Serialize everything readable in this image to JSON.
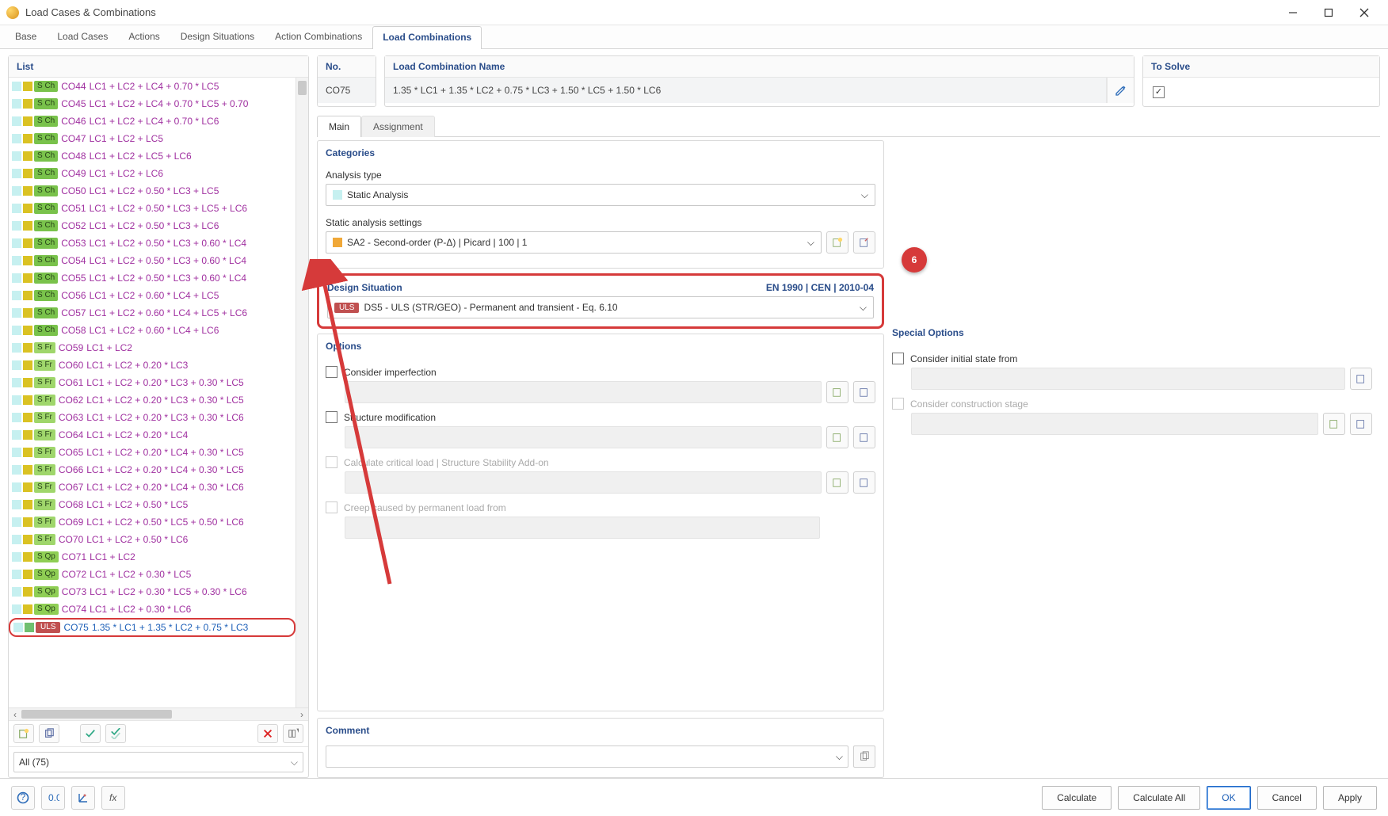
{
  "window": {
    "title": "Load Cases & Combinations"
  },
  "tabs": [
    "Base",
    "Load Cases",
    "Actions",
    "Design Situations",
    "Action Combinations",
    "Load Combinations"
  ],
  "active_tab": 5,
  "list": {
    "header": "List",
    "filter": "All (75)",
    "rows": [
      {
        "badge": "S Ch",
        "cls": "sch",
        "sq": "#dac223",
        "co": "CO44",
        "txt": "LC1 + LC2 + LC4 + 0.70 * LC5"
      },
      {
        "badge": "S Ch",
        "cls": "sch",
        "sq": "#dac223",
        "co": "CO45",
        "txt": "LC1 + LC2 + LC4 + 0.70 * LC5 + 0.70"
      },
      {
        "badge": "S Ch",
        "cls": "sch",
        "sq": "#dac223",
        "co": "CO46",
        "txt": "LC1 + LC2 + LC4 + 0.70 * LC6"
      },
      {
        "badge": "S Ch",
        "cls": "sch",
        "sq": "#dac223",
        "co": "CO47",
        "txt": "LC1 + LC2 + LC5"
      },
      {
        "badge": "S Ch",
        "cls": "sch",
        "sq": "#dac223",
        "co": "CO48",
        "txt": "LC1 + LC2 + LC5 + LC6"
      },
      {
        "badge": "S Ch",
        "cls": "sch",
        "sq": "#dac223",
        "co": "CO49",
        "txt": "LC1 + LC2 + LC6"
      },
      {
        "badge": "S Ch",
        "cls": "sch",
        "sq": "#dac223",
        "co": "CO50",
        "txt": "LC1 + LC2 + 0.50 * LC3 + LC5"
      },
      {
        "badge": "S Ch",
        "cls": "sch",
        "sq": "#dac223",
        "co": "CO51",
        "txt": "LC1 + LC2 + 0.50 * LC3 + LC5 + LC6"
      },
      {
        "badge": "S Ch",
        "cls": "sch",
        "sq": "#dac223",
        "co": "CO52",
        "txt": "LC1 + LC2 + 0.50 * LC3 + LC6"
      },
      {
        "badge": "S Ch",
        "cls": "sch",
        "sq": "#dac223",
        "co": "CO53",
        "txt": "LC1 + LC2 + 0.50 * LC3 + 0.60 * LC4"
      },
      {
        "badge": "S Ch",
        "cls": "sch",
        "sq": "#dac223",
        "co": "CO54",
        "txt": "LC1 + LC2 + 0.50 * LC3 + 0.60 * LC4"
      },
      {
        "badge": "S Ch",
        "cls": "sch",
        "sq": "#dac223",
        "co": "CO55",
        "txt": "LC1 + LC2 + 0.50 * LC3 + 0.60 * LC4"
      },
      {
        "badge": "S Ch",
        "cls": "sch",
        "sq": "#dac223",
        "co": "CO56",
        "txt": "LC1 + LC2 + 0.60 * LC4 + LC5"
      },
      {
        "badge": "S Ch",
        "cls": "sch",
        "sq": "#dac223",
        "co": "CO57",
        "txt": "LC1 + LC2 + 0.60 * LC4 + LC5 + LC6"
      },
      {
        "badge": "S Ch",
        "cls": "sch",
        "sq": "#dac223",
        "co": "CO58",
        "txt": "LC1 + LC2 + 0.60 * LC4 + LC6"
      },
      {
        "badge": "S Fr",
        "cls": "sfr",
        "sq": "#dac223",
        "co": "CO59",
        "txt": "LC1 + LC2"
      },
      {
        "badge": "S Fr",
        "cls": "sfr",
        "sq": "#dac223",
        "co": "CO60",
        "txt": "LC1 + LC2 + 0.20 * LC3"
      },
      {
        "badge": "S Fr",
        "cls": "sfr",
        "sq": "#dac223",
        "co": "CO61",
        "txt": "LC1 + LC2 + 0.20 * LC3 + 0.30 * LC5"
      },
      {
        "badge": "S Fr",
        "cls": "sfr",
        "sq": "#dac223",
        "co": "CO62",
        "txt": "LC1 + LC2 + 0.20 * LC3 + 0.30 * LC5"
      },
      {
        "badge": "S Fr",
        "cls": "sfr",
        "sq": "#dac223",
        "co": "CO63",
        "txt": "LC1 + LC2 + 0.20 * LC3 + 0.30 * LC6"
      },
      {
        "badge": "S Fr",
        "cls": "sfr",
        "sq": "#dac223",
        "co": "CO64",
        "txt": "LC1 + LC2 + 0.20 * LC4"
      },
      {
        "badge": "S Fr",
        "cls": "sfr",
        "sq": "#dac223",
        "co": "CO65",
        "txt": "LC1 + LC2 + 0.20 * LC4 + 0.30 * LC5"
      },
      {
        "badge": "S Fr",
        "cls": "sfr",
        "sq": "#dac223",
        "co": "CO66",
        "txt": "LC1 + LC2 + 0.20 * LC4 + 0.30 * LC5"
      },
      {
        "badge": "S Fr",
        "cls": "sfr",
        "sq": "#dac223",
        "co": "CO67",
        "txt": "LC1 + LC2 + 0.20 * LC4 + 0.30 * LC6"
      },
      {
        "badge": "S Fr",
        "cls": "sfr",
        "sq": "#dac223",
        "co": "CO68",
        "txt": "LC1 + LC2 + 0.50 * LC5"
      },
      {
        "badge": "S Fr",
        "cls": "sfr",
        "sq": "#dac223",
        "co": "CO69",
        "txt": "LC1 + LC2 + 0.50 * LC5 + 0.50 * LC6"
      },
      {
        "badge": "S Fr",
        "cls": "sfr",
        "sq": "#dac223",
        "co": "CO70",
        "txt": "LC1 + LC2 + 0.50 * LC6"
      },
      {
        "badge": "S Qp",
        "cls": "sqp",
        "sq": "#dac223",
        "co": "CO71",
        "txt": "LC1 + LC2"
      },
      {
        "badge": "S Qp",
        "cls": "sqp",
        "sq": "#dac223",
        "co": "CO72",
        "txt": "LC1 + LC2 + 0.30 * LC5"
      },
      {
        "badge": "S Qp",
        "cls": "sqp",
        "sq": "#dac223",
        "co": "CO73",
        "txt": "LC1 + LC2 + 0.30 * LC5 + 0.30 * LC6"
      },
      {
        "badge": "S Qp",
        "cls": "sqp",
        "sq": "#dac223",
        "co": "CO74",
        "txt": "LC1 + LC2 + 0.30 * LC6"
      },
      {
        "badge": "ULS",
        "cls": "uls",
        "sq": "#6fbf6f",
        "co": "CO75",
        "txt": "1.35 * LC1 + 1.35 * LC2 + 0.75 * LC3",
        "sel": true
      }
    ]
  },
  "detail": {
    "no_hdr": "No.",
    "no_val": "CO75",
    "name_hdr": "Load Combination Name",
    "name_val": "1.35 * LC1 + 1.35 * LC2 + 0.75 * LC3 + 1.50 * LC5 + 1.50 * LC6",
    "solve_hdr": "To Solve",
    "subtabs": [
      "Main",
      "Assignment"
    ],
    "categories_hdr": "Categories",
    "analysis_type_lbl": "Analysis type",
    "analysis_type_val": "Static Analysis",
    "static_settings_lbl": "Static analysis settings",
    "static_settings_val": "SA2 - Second-order (P-Δ) | Picard | 100 | 1",
    "ds_hdr": "Design Situation",
    "ds_std": "EN 1990 | CEN | 2010-04",
    "ds_badge": "ULS",
    "ds_val": "DS5 - ULS (STR/GEO) - Permanent and transient - Eq. 6.10",
    "options_hdr": "Options",
    "opt1": "Consider imperfection",
    "opt2": "Structure modification",
    "opt3": "Calculate critical load | Structure Stability Add-on",
    "opt4": "Creep caused by permanent load from",
    "special_hdr": "Special Options",
    "sopt1": "Consider initial state from",
    "sopt2": "Consider construction stage",
    "comment_hdr": "Comment",
    "callout": "6"
  },
  "buttons": {
    "calculate": "Calculate",
    "calculate_all": "Calculate All",
    "ok": "OK",
    "cancel": "Cancel",
    "apply": "Apply"
  }
}
